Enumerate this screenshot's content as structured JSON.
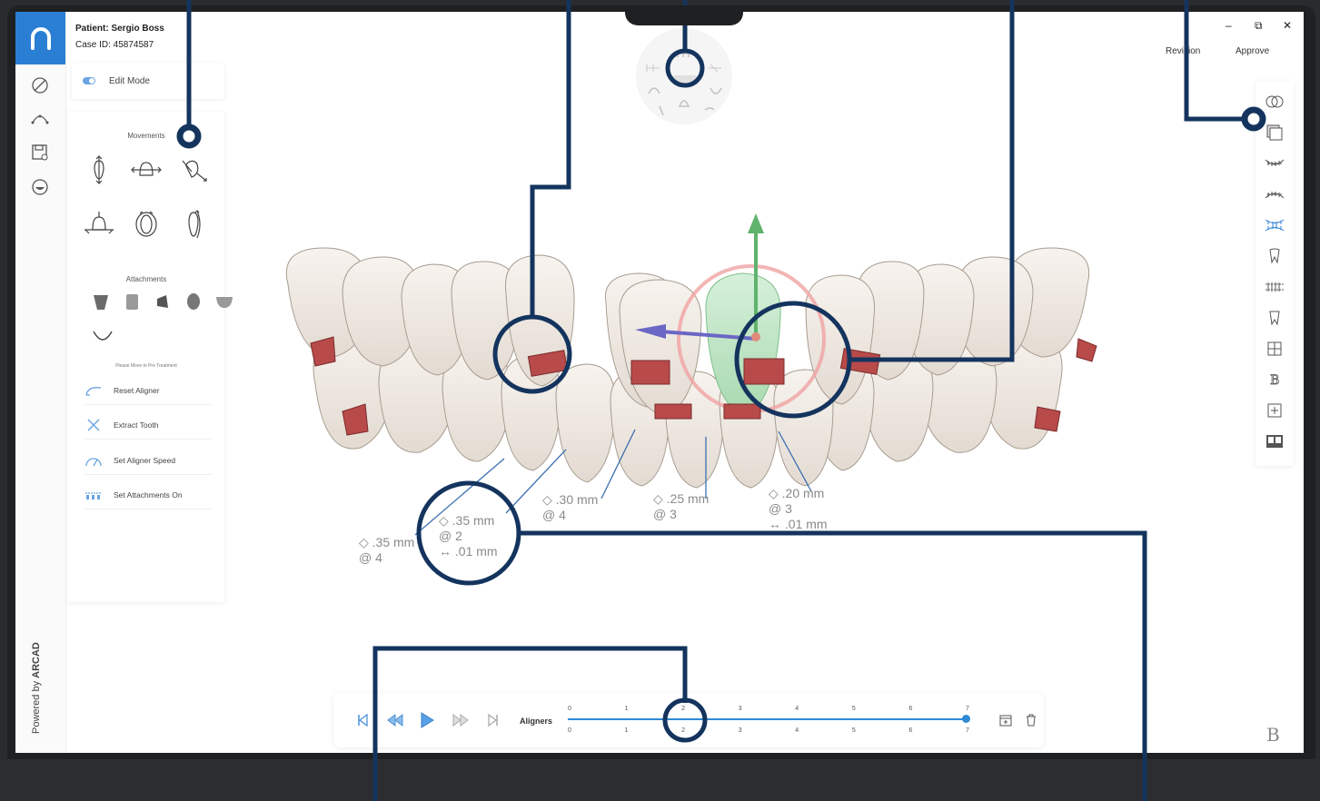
{
  "patient": {
    "name_label": "Patient:",
    "name": "Sergio Boss",
    "case_label": "Case ID:",
    "case_id": "45874587"
  },
  "edit_mode": {
    "label": "Edit Mode",
    "enabled": true
  },
  "panel": {
    "movements_title": "Movements",
    "attachments_title": "Attachments",
    "hint": "Please Move to Pre Treatment",
    "actions": [
      {
        "label": "Reset Aligner",
        "icon": "reset-icon"
      },
      {
        "label": "Extract Tooth",
        "icon": "extract-icon"
      },
      {
        "label": "Set Aligner Speed",
        "icon": "speed-icon"
      },
      {
        "label": "Set Attachments On",
        "icon": "attachments-on-icon"
      }
    ]
  },
  "header": {
    "revision": "Revision",
    "approve": "Approve",
    "minimize": "–",
    "restore": "⧉",
    "close": "✕"
  },
  "powered": {
    "prefix": "Powered by ",
    "brand": "ARCAD"
  },
  "measurements": [
    {
      "dist": ".35 mm",
      "at": "@  4",
      "extra": ""
    },
    {
      "dist": ".35 mm",
      "at": "@  2",
      "extra": "↔ .01 mm"
    },
    {
      "dist": ".30 mm",
      "at": "@  4",
      "extra": ""
    },
    {
      "dist": ".25 mm",
      "at": "@  3",
      "extra": ""
    },
    {
      "dist": ".20 mm",
      "at": "@  3",
      "extra": "↔ .01 mm"
    }
  ],
  "timeline": {
    "label": "Aligners",
    "top_ticks": [
      "0",
      "1",
      "2",
      "3",
      "4",
      "5",
      "6",
      "7"
    ],
    "bottom_ticks": [
      "0",
      "1",
      "2",
      "3",
      "4",
      "5",
      "6",
      "7"
    ],
    "current": 7,
    "max": 7
  },
  "colors": {
    "accent": "#2a7fd4",
    "callout": "#14345e",
    "attachment": "#b84a4a",
    "selected_tooth": "#bfe6c6"
  }
}
